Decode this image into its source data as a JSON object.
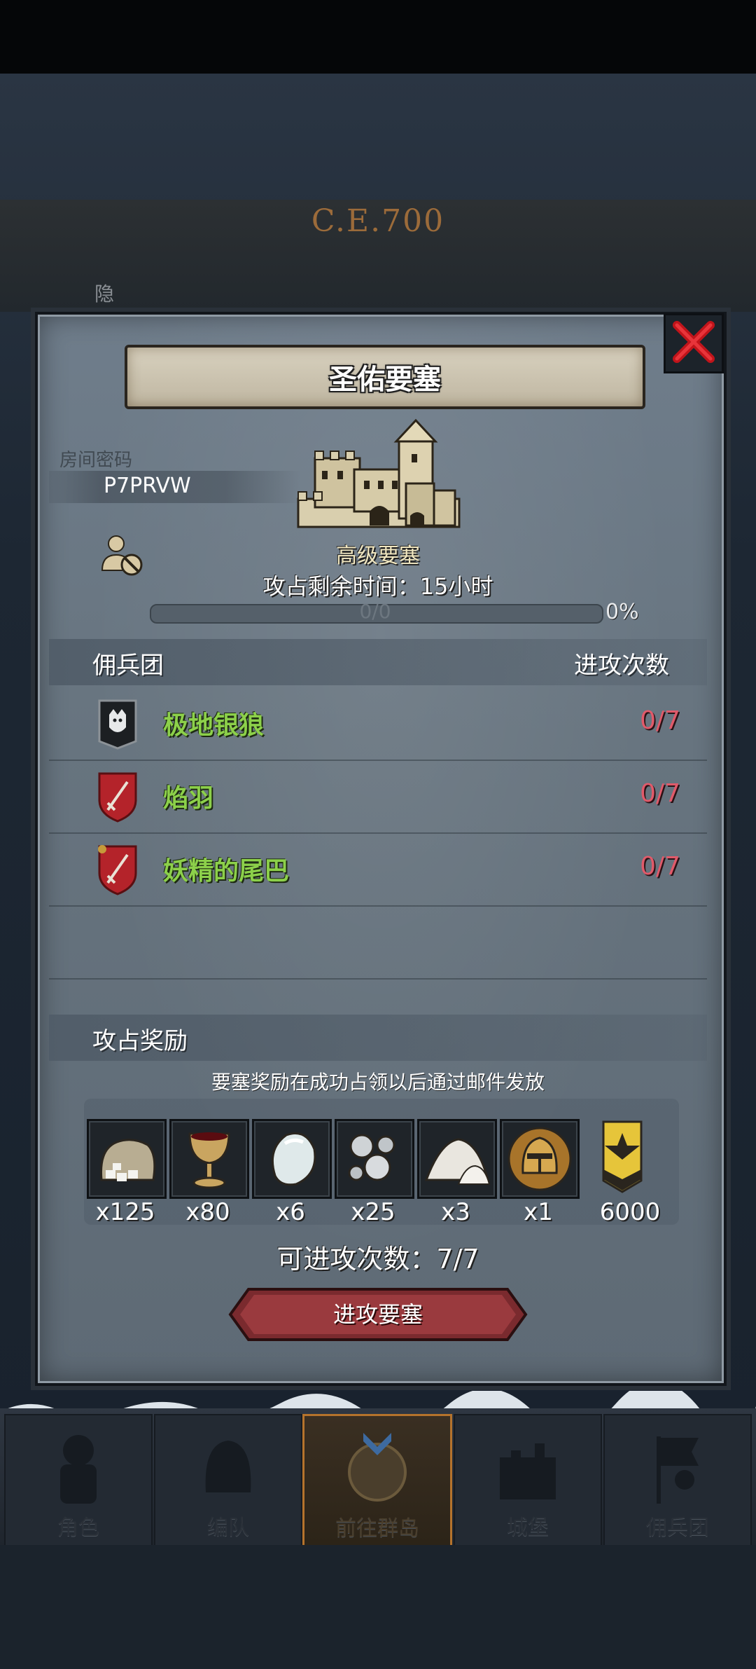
{
  "header": {
    "era": "C.E.700",
    "hidden_label": "隐"
  },
  "dialog": {
    "title": "圣佑要塞",
    "room_code_label": "房间密码",
    "room_code": "P7PRVW",
    "fortress_level": "高级要塞",
    "time_left": "攻占剩余时间：15小时",
    "progress_text": "0/0",
    "progress_percent": "0%",
    "progress_value": 0,
    "mercenaries": {
      "header_left": "佣兵团",
      "header_right": "进攻次数",
      "rows": [
        {
          "name": "极地银狼",
          "attacks": "0/7",
          "crest": "wolf-banner-icon"
        },
        {
          "name": "焰羽",
          "attacks": "0/7",
          "crest": "red-sword-shield-icon"
        },
        {
          "name": "妖精的尾巴",
          "attacks": "0/7",
          "crest": "red-sword-shield-icon"
        }
      ]
    },
    "rewards": {
      "title": "攻占奖励",
      "note": "要塞奖励在成功占领以后通过邮件发放",
      "items": [
        {
          "icon": "salt-sack-icon",
          "qty": "x125"
        },
        {
          "icon": "goblet-icon",
          "qty": "x80"
        },
        {
          "icon": "white-gem-icon",
          "qty": "x6"
        },
        {
          "icon": "silver-ore-icon",
          "qty": "x25"
        },
        {
          "icon": "white-powder-icon",
          "qty": "x3"
        },
        {
          "icon": "golden-helmet-icon",
          "qty": "x1"
        },
        {
          "icon": "guild-banner-icon",
          "qty": "6000"
        }
      ]
    },
    "attacks_left": "可进攻次数：7/7",
    "attack_button": "进攻要塞"
  },
  "nav": {
    "items": [
      {
        "label": "角色",
        "icon": "knight-icon"
      },
      {
        "label": "编队",
        "icon": "helmet-icon"
      },
      {
        "label": "前往群岛",
        "icon": "compass-icon"
      },
      {
        "label": "城堡",
        "icon": "castle-icon"
      },
      {
        "label": "佣兵团",
        "icon": "flag-knight-icon"
      }
    ]
  },
  "colors": {
    "merc_name": "#8cd04a",
    "attack_count": "#e05a6a",
    "active_nav_border": "#b5732c"
  }
}
